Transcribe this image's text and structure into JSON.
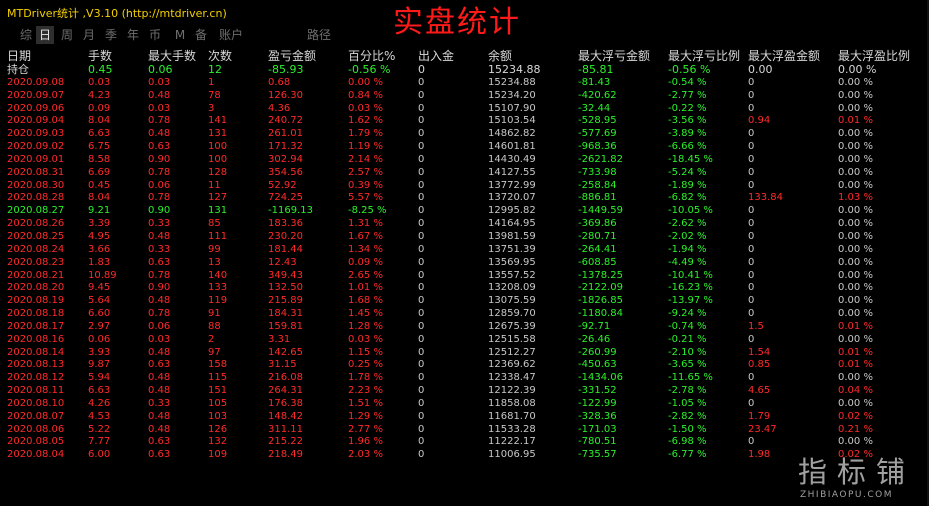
{
  "window": {
    "app_title": "MTDriver统计 ,V3.10 (http://mtdriver.cn)",
    "heading": "实盘统计"
  },
  "tabs": [
    {
      "label": "综",
      "active": false
    },
    {
      "label": "日",
      "active": true
    },
    {
      "label": "周",
      "active": false
    },
    {
      "label": "月",
      "active": false
    },
    {
      "label": "季",
      "active": false
    },
    {
      "label": "年",
      "active": false
    },
    {
      "label": "币",
      "active": false
    },
    {
      "label": "M",
      "active": false
    },
    {
      "label": "备",
      "active": false
    },
    {
      "label": "账户",
      "active": false
    },
    {
      "label": "路径",
      "active": false
    }
  ],
  "columns": [
    "日期",
    "手数",
    "最大手数",
    "次数",
    "盈亏金额",
    "百分比%",
    "出入金",
    "余额",
    "最大浮亏金额",
    "最大浮亏比例",
    "最大浮盈金额",
    "最大浮盈比例"
  ],
  "holding": {
    "date": "持仓",
    "lots": "0.45",
    "max_lots": "0.06",
    "count": "12",
    "pnl": "-85.93",
    "pct": "-0.56 %",
    "flow": "0",
    "balance": "15234.88",
    "max_float_loss": "-85.81",
    "max_float_loss_pct": "-0.56 %",
    "max_float_profit": "0.00",
    "max_float_profit_pct": "0.00 %"
  },
  "rows": [
    {
      "date": "2020.09.08",
      "lots": "0.03",
      "max_lots": "0.03",
      "count": "1",
      "pnl": "0.68",
      "pct": "0.00 %",
      "flow": "0",
      "balance": "15234.88",
      "mfl": "-81.43",
      "mflp": "-0.54 %",
      "mfp": "0",
      "mfpp": "0.00 %",
      "sign": "pos"
    },
    {
      "date": "2020.09.07",
      "lots": "4.23",
      "max_lots": "0.48",
      "count": "78",
      "pnl": "126.30",
      "pct": "0.84 %",
      "flow": "0",
      "balance": "15234.20",
      "mfl": "-420.62",
      "mflp": "-2.77 %",
      "mfp": "0",
      "mfpp": "0.00 %",
      "sign": "pos"
    },
    {
      "date": "2020.09.06",
      "lots": "0.09",
      "max_lots": "0.03",
      "count": "3",
      "pnl": "4.36",
      "pct": "0.03 %",
      "flow": "0",
      "balance": "15107.90",
      "mfl": "-32.44",
      "mflp": "-0.22 %",
      "mfp": "0",
      "mfpp": "0.00 %",
      "sign": "pos"
    },
    {
      "date": "2020.09.04",
      "lots": "8.04",
      "max_lots": "0.78",
      "count": "141",
      "pnl": "240.72",
      "pct": "1.62 %",
      "flow": "0",
      "balance": "15103.54",
      "mfl": "-528.95",
      "mflp": "-3.56 %",
      "mfp": "0.94",
      "mfpp": "0.01 %",
      "sign": "pos"
    },
    {
      "date": "2020.09.03",
      "lots": "6.63",
      "max_lots": "0.48",
      "count": "131",
      "pnl": "261.01",
      "pct": "1.79 %",
      "flow": "0",
      "balance": "14862.82",
      "mfl": "-577.69",
      "mflp": "-3.89 %",
      "mfp": "0",
      "mfpp": "0.00 %",
      "sign": "pos"
    },
    {
      "date": "2020.09.02",
      "lots": "6.75",
      "max_lots": "0.63",
      "count": "100",
      "pnl": "171.32",
      "pct": "1.19 %",
      "flow": "0",
      "balance": "14601.81",
      "mfl": "-968.36",
      "mflp": "-6.66 %",
      "mfp": "0",
      "mfpp": "0.00 %",
      "sign": "pos"
    },
    {
      "date": "2020.09.01",
      "lots": "8.58",
      "max_lots": "0.90",
      "count": "100",
      "pnl": "302.94",
      "pct": "2.14 %",
      "flow": "0",
      "balance": "14430.49",
      "mfl": "-2621.82",
      "mflp": "-18.45 %",
      "mfp": "0",
      "mfpp": "0.00 %",
      "sign": "pos"
    },
    {
      "date": "2020.08.31",
      "lots": "6.69",
      "max_lots": "0.78",
      "count": "128",
      "pnl": "354.56",
      "pct": "2.57 %",
      "flow": "0",
      "balance": "14127.55",
      "mfl": "-733.98",
      "mflp": "-5.24 %",
      "mfp": "0",
      "mfpp": "0.00 %",
      "sign": "pos"
    },
    {
      "date": "2020.08.30",
      "lots": "0.45",
      "max_lots": "0.06",
      "count": "11",
      "pnl": "52.92",
      "pct": "0.39 %",
      "flow": "0",
      "balance": "13772.99",
      "mfl": "-258.84",
      "mflp": "-1.89 %",
      "mfp": "0",
      "mfpp": "0.00 %",
      "sign": "pos"
    },
    {
      "date": "2020.08.28",
      "lots": "8.04",
      "max_lots": "0.78",
      "count": "127",
      "pnl": "724.25",
      "pct": "5.57 %",
      "flow": "0",
      "balance": "13720.07",
      "mfl": "-886.81",
      "mflp": "-6.82 %",
      "mfp": "133.84",
      "mfpp": "1.03 %",
      "sign": "pos"
    },
    {
      "date": "2020.08.27",
      "lots": "9.21",
      "max_lots": "0.90",
      "count": "131",
      "pnl": "-1169.13",
      "pct": "-8.25 %",
      "flow": "0",
      "balance": "12995.82",
      "mfl": "-1449.59",
      "mflp": "-10.05 %",
      "mfp": "0",
      "mfpp": "0.00 %",
      "sign": "neg"
    },
    {
      "date": "2020.08.26",
      "lots": "3.39",
      "max_lots": "0.33",
      "count": "85",
      "pnl": "183.36",
      "pct": "1.31 %",
      "flow": "0",
      "balance": "14164.95",
      "mfl": "-369.86",
      "mflp": "-2.62 %",
      "mfp": "0",
      "mfpp": "0.00 %",
      "sign": "pos"
    },
    {
      "date": "2020.08.25",
      "lots": "4.95",
      "max_lots": "0.48",
      "count": "111",
      "pnl": "230.20",
      "pct": "1.67 %",
      "flow": "0",
      "balance": "13981.59",
      "mfl": "-280.71",
      "mflp": "-2.02 %",
      "mfp": "0",
      "mfpp": "0.00 %",
      "sign": "pos"
    },
    {
      "date": "2020.08.24",
      "lots": "3.66",
      "max_lots": "0.33",
      "count": "99",
      "pnl": "181.44",
      "pct": "1.34 %",
      "flow": "0",
      "balance": "13751.39",
      "mfl": "-264.41",
      "mflp": "-1.94 %",
      "mfp": "0",
      "mfpp": "0.00 %",
      "sign": "pos"
    },
    {
      "date": "2020.08.23",
      "lots": "1.83",
      "max_lots": "0.63",
      "count": "13",
      "pnl": "12.43",
      "pct": "0.09 %",
      "flow": "0",
      "balance": "13569.95",
      "mfl": "-608.85",
      "mflp": "-4.49 %",
      "mfp": "0",
      "mfpp": "0.00 %",
      "sign": "pos"
    },
    {
      "date": "2020.08.21",
      "lots": "10.89",
      "max_lots": "0.78",
      "count": "140",
      "pnl": "349.43",
      "pct": "2.65 %",
      "flow": "0",
      "balance": "13557.52",
      "mfl": "-1378.25",
      "mflp": "-10.41 %",
      "mfp": "0",
      "mfpp": "0.00 %",
      "sign": "pos"
    },
    {
      "date": "2020.08.20",
      "lots": "9.45",
      "max_lots": "0.90",
      "count": "133",
      "pnl": "132.50",
      "pct": "1.01 %",
      "flow": "0",
      "balance": "13208.09",
      "mfl": "-2122.09",
      "mflp": "-16.23 %",
      "mfp": "0",
      "mfpp": "0.00 %",
      "sign": "pos"
    },
    {
      "date": "2020.08.19",
      "lots": "5.64",
      "max_lots": "0.48",
      "count": "119",
      "pnl": "215.89",
      "pct": "1.68 %",
      "flow": "0",
      "balance": "13075.59",
      "mfl": "-1826.85",
      "mflp": "-13.97 %",
      "mfp": "0",
      "mfpp": "0.00 %",
      "sign": "pos"
    },
    {
      "date": "2020.08.18",
      "lots": "6.60",
      "max_lots": "0.78",
      "count": "91",
      "pnl": "184.31",
      "pct": "1.45 %",
      "flow": "0",
      "balance": "12859.70",
      "mfl": "-1180.84",
      "mflp": "-9.24 %",
      "mfp": "0",
      "mfpp": "0.00 %",
      "sign": "pos"
    },
    {
      "date": "2020.08.17",
      "lots": "2.97",
      "max_lots": "0.06",
      "count": "88",
      "pnl": "159.81",
      "pct": "1.28 %",
      "flow": "0",
      "balance": "12675.39",
      "mfl": "-92.71",
      "mflp": "-0.74 %",
      "mfp": "1.5",
      "mfpp": "0.01 %",
      "sign": "pos"
    },
    {
      "date": "2020.08.16",
      "lots": "0.06",
      "max_lots": "0.03",
      "count": "2",
      "pnl": "3.31",
      "pct": "0.03 %",
      "flow": "0",
      "balance": "12515.58",
      "mfl": "-26.46",
      "mflp": "-0.21 %",
      "mfp": "0",
      "mfpp": "0.00 %",
      "sign": "pos"
    },
    {
      "date": "2020.08.14",
      "lots": "3.93",
      "max_lots": "0.48",
      "count": "97",
      "pnl": "142.65",
      "pct": "1.15 %",
      "flow": "0",
      "balance": "12512.27",
      "mfl": "-260.99",
      "mflp": "-2.10 %",
      "mfp": "1.54",
      "mfpp": "0.01 %",
      "sign": "pos"
    },
    {
      "date": "2020.08.13",
      "lots": "9.87",
      "max_lots": "0.63",
      "count": "158",
      "pnl": "31.15",
      "pct": "0.25 %",
      "flow": "0",
      "balance": "12369.62",
      "mfl": "-450.63",
      "mflp": "-3.65 %",
      "mfp": "0.85",
      "mfpp": "0.01 %",
      "sign": "pos"
    },
    {
      "date": "2020.08.12",
      "lots": "5.94",
      "max_lots": "0.48",
      "count": "115",
      "pnl": "216.08",
      "pct": "1.78 %",
      "flow": "0",
      "balance": "12338.47",
      "mfl": "-1434.06",
      "mflp": "-11.65 %",
      "mfp": "0",
      "mfpp": "0.00 %",
      "sign": "pos"
    },
    {
      "date": "2020.08.11",
      "lots": "6.63",
      "max_lots": "0.48",
      "count": "151",
      "pnl": "264.31",
      "pct": "2.23 %",
      "flow": "0",
      "balance": "12122.39",
      "mfl": "-331.52",
      "mflp": "-2.78 %",
      "mfp": "4.65",
      "mfpp": "0.04 %",
      "sign": "pos"
    },
    {
      "date": "2020.08.10",
      "lots": "4.26",
      "max_lots": "0.33",
      "count": "105",
      "pnl": "176.38",
      "pct": "1.51 %",
      "flow": "0",
      "balance": "11858.08",
      "mfl": "-122.99",
      "mflp": "-1.05 %",
      "mfp": "0",
      "mfpp": "0.00 %",
      "sign": "pos"
    },
    {
      "date": "2020.08.07",
      "lots": "4.53",
      "max_lots": "0.48",
      "count": "103",
      "pnl": "148.42",
      "pct": "1.29 %",
      "flow": "0",
      "balance": "11681.70",
      "mfl": "-328.36",
      "mflp": "-2.82 %",
      "mfp": "1.79",
      "mfpp": "0.02 %",
      "sign": "pos"
    },
    {
      "date": "2020.08.06",
      "lots": "5.22",
      "max_lots": "0.48",
      "count": "126",
      "pnl": "311.11",
      "pct": "2.77 %",
      "flow": "0",
      "balance": "11533.28",
      "mfl": "-171.03",
      "mflp": "-1.50 %",
      "mfp": "23.47",
      "mfpp": "0.21 %",
      "sign": "pos"
    },
    {
      "date": "2020.08.05",
      "lots": "7.77",
      "max_lots": "0.63",
      "count": "132",
      "pnl": "215.22",
      "pct": "1.96 %",
      "flow": "0",
      "balance": "11222.17",
      "mfl": "-780.51",
      "mflp": "-6.98 %",
      "mfp": "0",
      "mfpp": "0.00 %",
      "sign": "pos"
    },
    {
      "date": "2020.08.04",
      "lots": "6.00",
      "max_lots": "0.63",
      "count": "109",
      "pnl": "218.49",
      "pct": "2.03 %",
      "flow": "0",
      "balance": "11006.95",
      "mfl": "-735.57",
      "mflp": "-6.77 %",
      "mfp": "1.98",
      "mfpp": "0.02 %",
      "sign": "pos"
    }
  ],
  "watermark": {
    "cn": "指标铺",
    "en": "ZHIBIAOPU.COM"
  },
  "colors": {
    "profit": "#ff2a2a",
    "loss": "#2cf02c",
    "neutral": "#c8c8c8",
    "title": "#f5d000",
    "heading": "#ff1a1a"
  }
}
